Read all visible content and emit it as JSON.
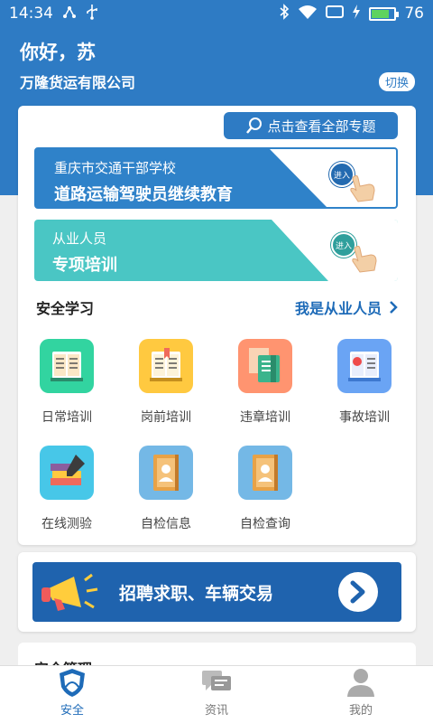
{
  "status_bar": {
    "time": "14:34",
    "battery_level": "76",
    "battery_fraction": 0.76
  },
  "header": {
    "greeting": "你好，苏",
    "company": "万隆货运有限公司",
    "switch_label": "切换"
  },
  "topics_button": {
    "label": "点击查看全部专题"
  },
  "banners": [
    {
      "subtitle": "重庆市交通干部学校",
      "title": "道路运输驾驶员继续教育",
      "enter_label": "进入"
    },
    {
      "subtitle": "从业人员",
      "title": "专项培训",
      "enter_label": "进入"
    }
  ],
  "safety_study": {
    "title": "安全学习",
    "link_label": "我是从业人员",
    "items": [
      {
        "label": "日常培训",
        "icon": "book-icon"
      },
      {
        "label": "岗前培训",
        "icon": "open-book-icon"
      },
      {
        "label": "违章培训",
        "icon": "violation-book-icon"
      },
      {
        "label": "事故培训",
        "icon": "accident-book-icon"
      },
      {
        "label": "在线测验",
        "icon": "books-pen-icon"
      },
      {
        "label": "自检信息",
        "icon": "profile-book-icon"
      },
      {
        "label": "自检查询",
        "icon": "profile-search-icon"
      }
    ]
  },
  "recruit": {
    "label": "招聘求职、车辆交易"
  },
  "next_section": {
    "title": "安全管理"
  },
  "tabbar": [
    {
      "label": "安全",
      "icon": "shield-icon",
      "active": true
    },
    {
      "label": "资讯",
      "icon": "chat-icon",
      "active": false
    },
    {
      "label": "我的",
      "icon": "user-icon",
      "active": false
    }
  ],
  "colors": {
    "primary": "#2e7bc4",
    "teal": "#4ac6c4",
    "link": "#1e6bb8"
  }
}
